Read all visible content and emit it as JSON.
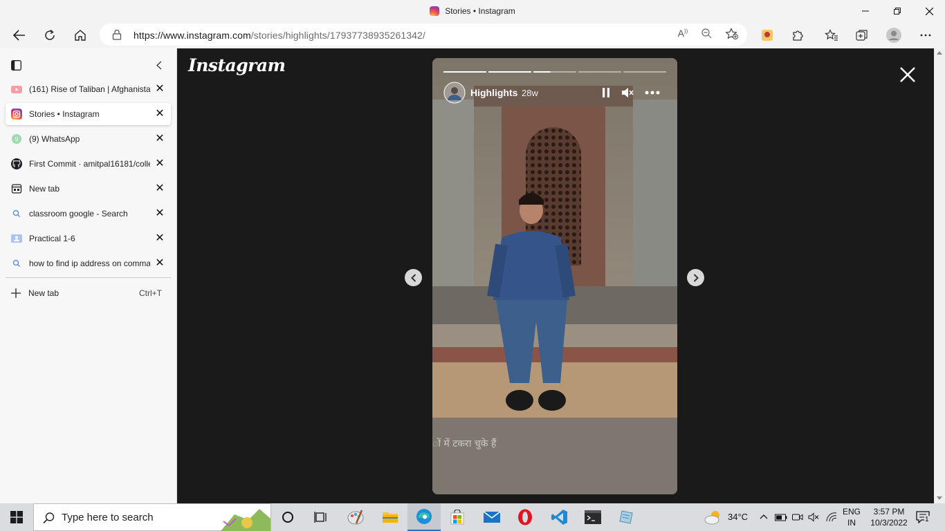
{
  "window": {
    "title": "Stories • Instagram"
  },
  "toolbar": {
    "url_prefix": "https://www.instagram.com",
    "url_path": "/stories/highlights/17937738935261342/"
  },
  "tabs": [
    {
      "label": "(161) Rise of Taliban | Afghanistan",
      "icon": "youtube-icon",
      "active": false
    },
    {
      "label": "Stories • Instagram",
      "icon": "instagram-icon",
      "active": true
    },
    {
      "label": "(9) WhatsApp",
      "icon": "whatsapp-icon",
      "active": false
    },
    {
      "label": "First Commit · amitpal16181/colle",
      "icon": "github-icon",
      "active": false
    },
    {
      "label": "New tab",
      "icon": "newtab-icon",
      "active": false
    },
    {
      "label": "classroom google - Search",
      "icon": "search-icon",
      "active": false
    },
    {
      "label": "Practical 1-6",
      "icon": "classroom-icon",
      "active": false
    },
    {
      "label": "how to find ip address on comma",
      "icon": "search-icon",
      "active": false
    }
  ],
  "sidebar": {
    "new_tab_label": "New tab",
    "new_tab_shortcut": "Ctrl+T"
  },
  "story": {
    "brand": "Instagram",
    "user": "Highlights",
    "age": "28w",
    "caption_overlay": "ों में टकरा चुके हैं",
    "progress_segments": [
      1,
      1,
      0.4,
      0,
      0
    ]
  },
  "taskbar": {
    "search_placeholder": "Type here to search",
    "weather": "34°C",
    "lang_top": "ENG",
    "lang_bottom": "IN",
    "time": "3:57 PM",
    "date": "10/3/2022",
    "notifications": "1"
  }
}
